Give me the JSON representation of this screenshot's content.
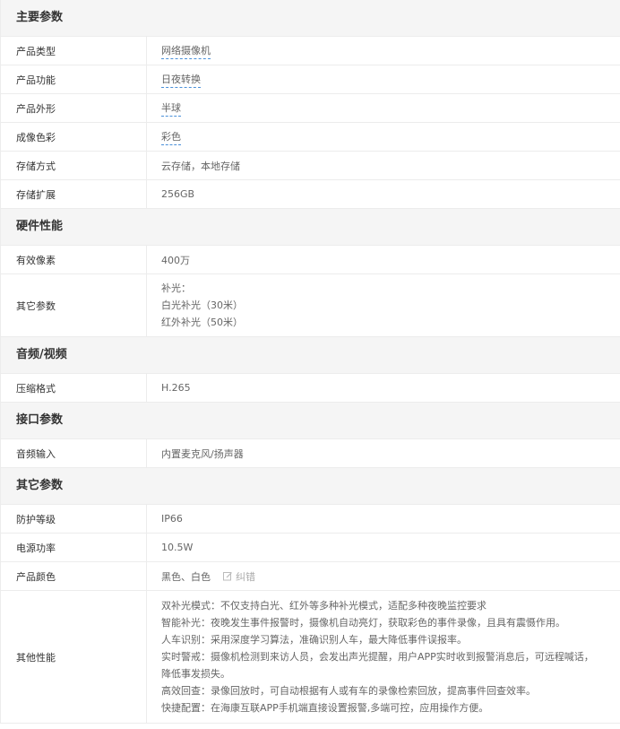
{
  "sections": [
    {
      "title": "主要参数",
      "rows": [
        {
          "key": "产品类型",
          "value": "网络摄像机"
        },
        {
          "key": "产品功能",
          "value": "日夜转换"
        },
        {
          "key": "产品外形",
          "value": "半球"
        },
        {
          "key": "成像色彩",
          "value": "彩色"
        },
        {
          "key": "存储方式",
          "value": "云存储，本地存储"
        },
        {
          "key": "存储扩展",
          "value": "256GB"
        }
      ]
    },
    {
      "title": "硬件性能",
      "rows": [
        {
          "key": "有效像素",
          "value": "400万"
        },
        {
          "key": "其它参数",
          "lines": [
            "补光：",
            "白光补光（30米）",
            "红外补光（50米）"
          ]
        }
      ]
    },
    {
      "title": "音频/视频",
      "rows": [
        {
          "key": "压缩格式",
          "value": "H.265"
        }
      ]
    },
    {
      "title": "接口参数",
      "rows": [
        {
          "key": "音频输入",
          "value": "内置麦克风/扬声器"
        }
      ]
    },
    {
      "title": "其它参数",
      "rows": [
        {
          "key": "防护等级",
          "value": "IP66"
        },
        {
          "key": "电源功率",
          "value": "10.5W"
        },
        {
          "key": "产品颜色",
          "value": "黑色、白色",
          "action": "纠错"
        },
        {
          "key": "其他性能",
          "lines": [
            "双补光模式：不仅支持白光、红外等多种补光模式，适配多种夜晚监控要求",
            "智能补光：夜晚发生事件报警时，摄像机自动亮灯，获取彩色的事件录像，且具有震慑作用。",
            "人车识别：采用深度学习算法，准确识别人车，最大降低事件误报率。",
            "实时警戒：摄像机检测到来访人员，会发出声光提醒，用户APP实时收到报警消息后，可远程喊话，",
            "降低事发损失。",
            "高效回查：录像回放时，可自动根据有人或有车的录像检索回放，提高事件回查效率。",
            "快捷配置：在海康互联APP手机端直接设置报警,多端可控，应用操作方便。"
          ]
        }
      ]
    }
  ]
}
